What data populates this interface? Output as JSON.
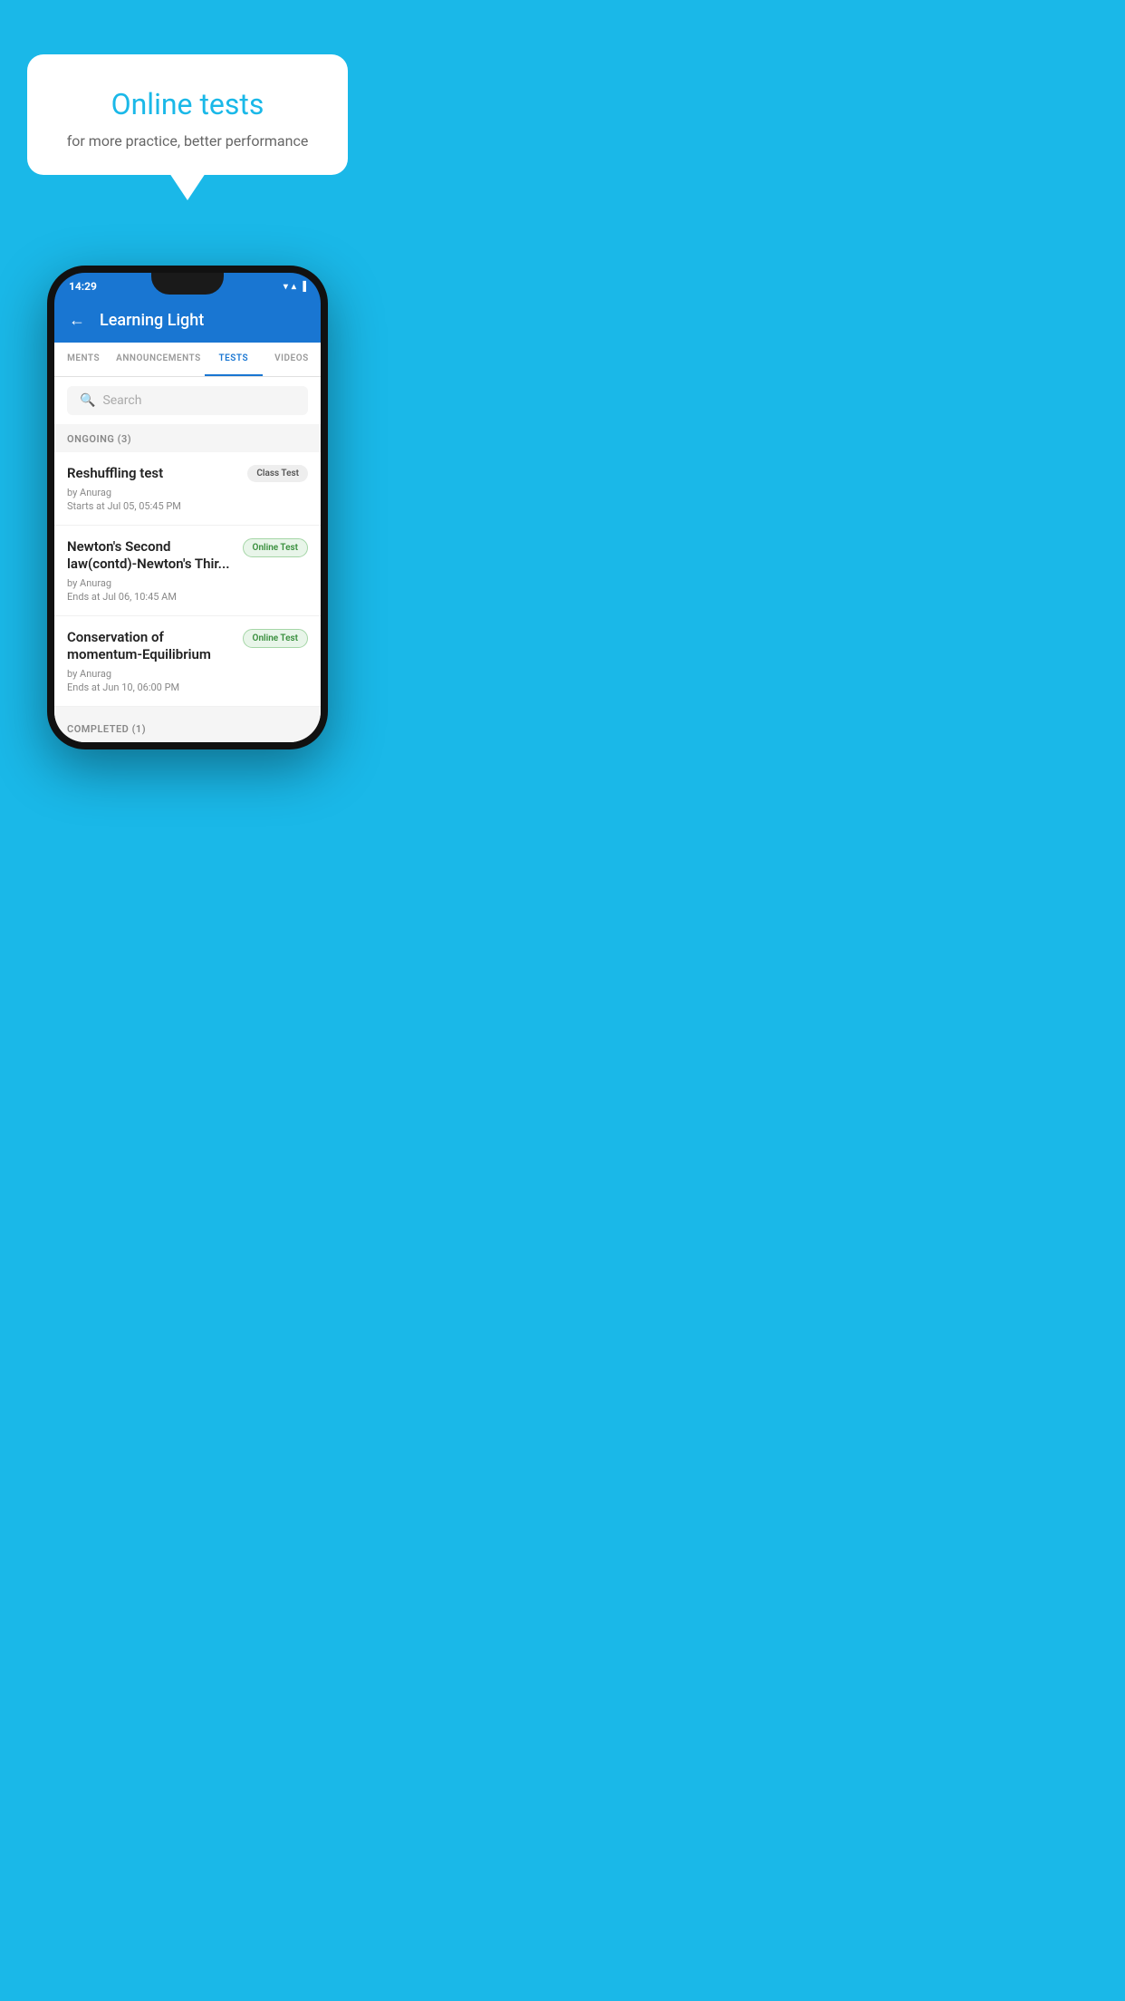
{
  "hero": {
    "title": "Online tests",
    "subtitle": "for more practice, better performance"
  },
  "phone": {
    "statusBar": {
      "time": "14:29",
      "icons": [
        "▼",
        "▲",
        "▐"
      ]
    },
    "header": {
      "backIcon": "←",
      "title": "Learning Light"
    },
    "tabs": [
      {
        "label": "MENTS",
        "active": false
      },
      {
        "label": "ANNOUNCEMENTS",
        "active": false
      },
      {
        "label": "TESTS",
        "active": true
      },
      {
        "label": "VIDEOS",
        "active": false
      }
    ],
    "search": {
      "placeholder": "Search",
      "icon": "🔍"
    },
    "ongoingLabel": "ONGOING (3)",
    "tests": [
      {
        "title": "Reshuffling test",
        "badge": "Class Test",
        "badgeType": "class",
        "author": "by Anurag",
        "dateLabel": "Starts at",
        "date": "Jul 05, 05:45 PM"
      },
      {
        "title": "Newton's Second law(contd)-Newton's Thir...",
        "badge": "Online Test",
        "badgeType": "online",
        "author": "by Anurag",
        "dateLabel": "Ends at",
        "date": "Jul 06, 10:45 AM"
      },
      {
        "title": "Conservation of momentum-Equilibrium",
        "badge": "Online Test",
        "badgeType": "online",
        "author": "by Anurag",
        "dateLabel": "Ends at",
        "date": "Jun 10, 06:00 PM"
      }
    ],
    "completedLabel": "COMPLETED (1)"
  }
}
